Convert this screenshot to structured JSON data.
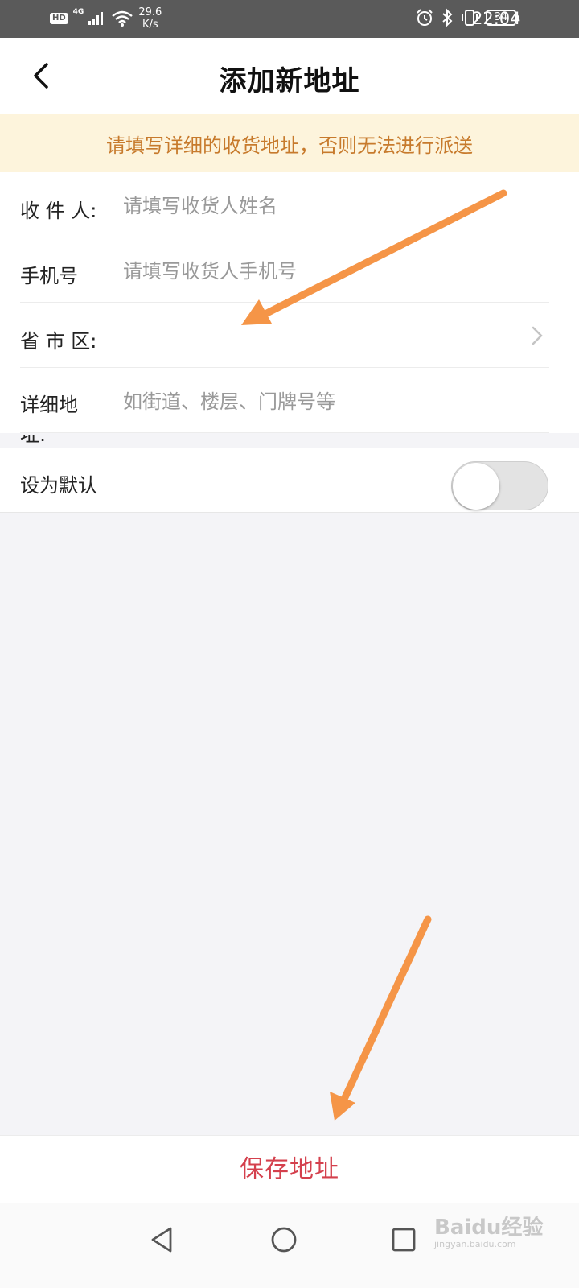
{
  "status_bar": {
    "hd": "HD",
    "network": "4G",
    "speed_value": "29.6",
    "speed_unit": "K/s",
    "battery": "34",
    "time": "22:04"
  },
  "header": {
    "title": "添加新地址"
  },
  "notice": {
    "text": "请填写详细的收货地址，否则无法进行派送"
  },
  "form": {
    "recipient": {
      "label": "收 件 人:",
      "placeholder": "请填写收货人姓名",
      "value": ""
    },
    "phone": {
      "label": "手机号",
      "placeholder": "请填写收货人手机号",
      "value": ""
    },
    "region": {
      "label": "省 市 区:",
      "value": ""
    },
    "address": {
      "label": "详细地",
      "label_overflow": "址:",
      "placeholder": "如街道、楼层、门牌号等",
      "value": ""
    },
    "default": {
      "label": "设为默认",
      "on": false
    }
  },
  "save_button": {
    "label": "保存地址"
  },
  "watermark": {
    "brand": "Baidu经验",
    "url": "jingyan.baidu.com"
  },
  "colors": {
    "accent": "#d4404d",
    "notice_bg": "#fdf4dc",
    "notice_text": "#c77a2c",
    "annotation_arrow": "#f59547",
    "status_bar": "#5a5a5a"
  },
  "icons": {
    "back": "chevron-left-icon",
    "region_chevron": "chevron-right-icon",
    "nav_back": "triangle-back-icon",
    "nav_home": "circle-home-icon",
    "nav_recent": "square-recent-icon"
  }
}
